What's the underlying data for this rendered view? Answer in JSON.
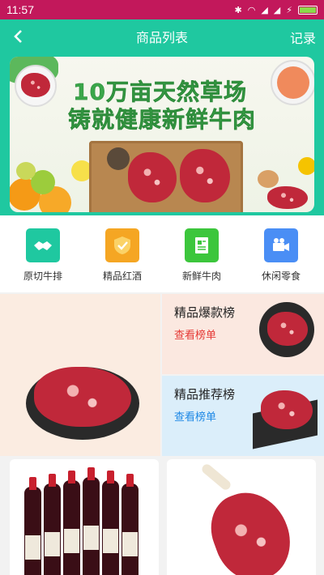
{
  "status_bar": {
    "time": "11:57"
  },
  "header": {
    "title": "商品列表",
    "right_action": "记录"
  },
  "banner": {
    "line1": "10万亩天然草场",
    "line2": "铸就健康新鲜牛肉"
  },
  "categories": [
    {
      "label": "原切牛排",
      "icon": "handshake-icon",
      "color": "#1fc8a0"
    },
    {
      "label": "精品红酒",
      "icon": "shield-check-icon",
      "color": "#f5a623"
    },
    {
      "label": "新鲜牛肉",
      "icon": "document-icon",
      "color": "#3cc63c"
    },
    {
      "label": "休闲零食",
      "icon": "video-camera-icon",
      "color": "#4a8ef5"
    }
  ],
  "promo": {
    "hot": {
      "title": "精品爆款榜",
      "link": "查看榜单",
      "link_color": "#e53935"
    },
    "recommend": {
      "title": "精品推荐榜",
      "link": "查看榜单",
      "link_color": "#1e88e5"
    }
  }
}
